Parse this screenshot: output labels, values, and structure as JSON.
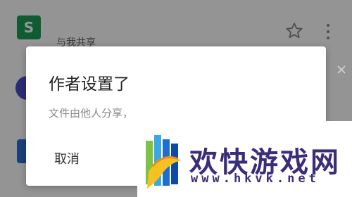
{
  "file_list": {
    "row1": {
      "icon_letter": "S",
      "icon_color": "#1e9e58",
      "subtitle": "与我共享"
    },
    "row2": {
      "icon_color": "#4a4ec8"
    },
    "row3": {
      "icon_color": "#2b6fd6"
    }
  },
  "dialog": {
    "title": "作者设置了",
    "body": "文件由他人分享，",
    "cancel_label": "取消"
  },
  "watermark": {
    "title": "欢快游戏网",
    "url": "www.hkvk.net",
    "text_color": "#3a2d7a"
  }
}
